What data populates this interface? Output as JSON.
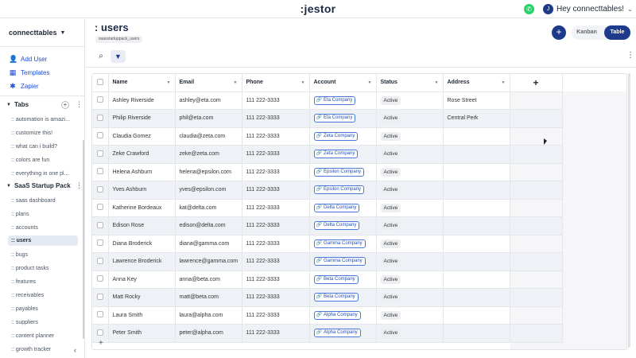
{
  "topbar": {
    "brand": ":jestor",
    "greeting": "Hey connecttables!",
    "avatar_initial": "J",
    "whatsapp_icon": "whatsapp-icon"
  },
  "sidebar": {
    "workspace": "connecttables",
    "links": [
      {
        "label": "Add User",
        "icon": "add-user-icon"
      },
      {
        "label": "Templates",
        "icon": "templates-icon"
      },
      {
        "label": "Zapier",
        "icon": "zapier-icon"
      }
    ],
    "tabs_section": "Tabs",
    "tabs_items": [
      ":: automation is amazi...",
      ":: customize this!",
      ":: what can i build?",
      ":: colors are fun",
      ":: everything in one pl..."
    ],
    "pack_section": "SaaS Startup Pack",
    "pack_items": [
      ":: saas dashboard",
      ":: plans",
      ":: accounts",
      ":: users",
      ":: bugs",
      ":: product tasks",
      ":: features",
      ":: receivables",
      ":: payables",
      ":: suppliers",
      ":: content planner",
      ":: growth tracker"
    ],
    "active_item": ":: users"
  },
  "header": {
    "title": ": users",
    "tag": "saasstartuppack_users",
    "view_kanban": "Kanban",
    "view_table": "Table"
  },
  "table": {
    "columns": [
      "Name",
      "Email",
      "Phone",
      "Account",
      "Status",
      "Address"
    ],
    "rows": [
      {
        "name": "Ashley Riverside",
        "email": "ashley@eta.com",
        "phone": "111 222-3333",
        "account": "Eta Company",
        "status": "Active",
        "address": "Rose Street"
      },
      {
        "name": "Philip Riverside",
        "email": "phil@eta.com",
        "phone": "111 222-3333",
        "account": "Eta Company",
        "status": "Active",
        "address": "Central Perk"
      },
      {
        "name": "Claudia Gomez",
        "email": "claudia@zeta.com",
        "phone": "111 222-3333",
        "account": "Zeta Company",
        "status": "Active",
        "address": ""
      },
      {
        "name": "Zeke Crawford",
        "email": "zeke@zeta.com",
        "phone": "111 222-3333",
        "account": "Zeta Company",
        "status": "Active",
        "address": ""
      },
      {
        "name": "Helena Ashburn",
        "email": "helena@epsilon.com",
        "phone": "111 222-3333",
        "account": "Epsilon Company",
        "status": "Active",
        "address": ""
      },
      {
        "name": "Yves Ashburn",
        "email": "yves@epsilon.com",
        "phone": "111 222-3333",
        "account": "Epsilon Company",
        "status": "Active",
        "address": ""
      },
      {
        "name": "Katherine Bordeaux",
        "email": "kat@delta.com",
        "phone": "111 222-3333",
        "account": "Delta Company",
        "status": "Active",
        "address": ""
      },
      {
        "name": "Edison Rose",
        "email": "edison@delta.com",
        "phone": "111 222-3333",
        "account": "Delta Company",
        "status": "Active",
        "address": ""
      },
      {
        "name": "Diana Broderick",
        "email": "diana@gamma.com",
        "phone": "111 222-3333",
        "account": "Gamma Company",
        "status": "Active",
        "address": ""
      },
      {
        "name": "Lawrence Broderick",
        "email": "lawrence@gamma.com",
        "phone": "111 222-3333",
        "account": "Gamma Company",
        "status": "Active",
        "address": ""
      },
      {
        "name": "Anna Key",
        "email": "anna@beta.com",
        "phone": "111 222-3333",
        "account": "Beta Company",
        "status": "Active",
        "address": ""
      },
      {
        "name": "Matt Rocky",
        "email": "matt@beta.com",
        "phone": "111 222-3333",
        "account": "Beta Company",
        "status": "Active",
        "address": ""
      },
      {
        "name": "Laura Smith",
        "email": "laura@alpha.com",
        "phone": "111 222-3333",
        "account": "Alpha Company",
        "status": "Active",
        "address": ""
      },
      {
        "name": "Peter Smith",
        "email": "peter@alpha.com",
        "phone": "111 222-3333",
        "account": "Alpha Company",
        "status": "Active",
        "address": ""
      }
    ]
  }
}
